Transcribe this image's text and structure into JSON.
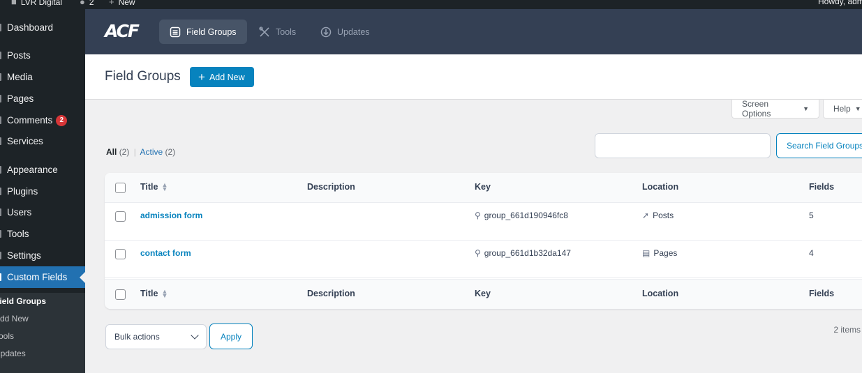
{
  "adminbar": {
    "site_name": "LVR Digital",
    "comments_count": "2",
    "new_label": "New",
    "howdy": "Howdy, adm"
  },
  "sidebar": {
    "items": [
      {
        "label": "Dashboard"
      },
      {
        "label": "Posts"
      },
      {
        "label": "Media"
      },
      {
        "label": "Pages"
      },
      {
        "label": "Comments",
        "badge": "2"
      },
      {
        "label": "Services"
      },
      {
        "label": "Appearance"
      },
      {
        "label": "Plugins"
      },
      {
        "label": "Users"
      },
      {
        "label": "Tools"
      },
      {
        "label": "Settings"
      },
      {
        "label": "Custom Fields"
      }
    ],
    "submenu": [
      "Field Groups",
      "Add New",
      "Tools",
      "Updates"
    ]
  },
  "acf_header": {
    "logo": "ACF",
    "tabs": [
      {
        "label": "Field Groups",
        "icon": "list-icon"
      },
      {
        "label": "Tools",
        "icon": "tools-icon"
      },
      {
        "label": "Updates",
        "icon": "download-circle-icon"
      }
    ]
  },
  "page": {
    "title": "Field Groups",
    "add_new_label": "Add New"
  },
  "screen_meta": {
    "screen_options": "Screen Options",
    "help": "Help"
  },
  "filters": {
    "all_label": "All",
    "all_count": "(2)",
    "separator": "|",
    "active_label": "Active",
    "active_count": "(2)"
  },
  "search": {
    "value": "",
    "button_label": "Search Field Groups"
  },
  "table": {
    "columns": [
      "Title",
      "Description",
      "Key",
      "Location",
      "Fields"
    ],
    "rows": [
      {
        "title": "admission form",
        "description": "",
        "key": "group_661d190946fc8",
        "location": "Posts",
        "location_icon": "pin-icon",
        "fields": "5"
      },
      {
        "title": "contact form",
        "description": "",
        "key": "group_661d1b32da147",
        "location": "Pages",
        "location_icon": "pages-icon",
        "fields": "4"
      }
    ]
  },
  "bulk": {
    "selected": "Bulk actions",
    "apply_label": "Apply",
    "items_count": "2 items"
  },
  "colors": {
    "admin_dark": "#1d2327",
    "acf_header": "#344054",
    "accent_blue": "#0783be",
    "wp_blue": "#2271b1",
    "badge_red": "#d63638"
  }
}
